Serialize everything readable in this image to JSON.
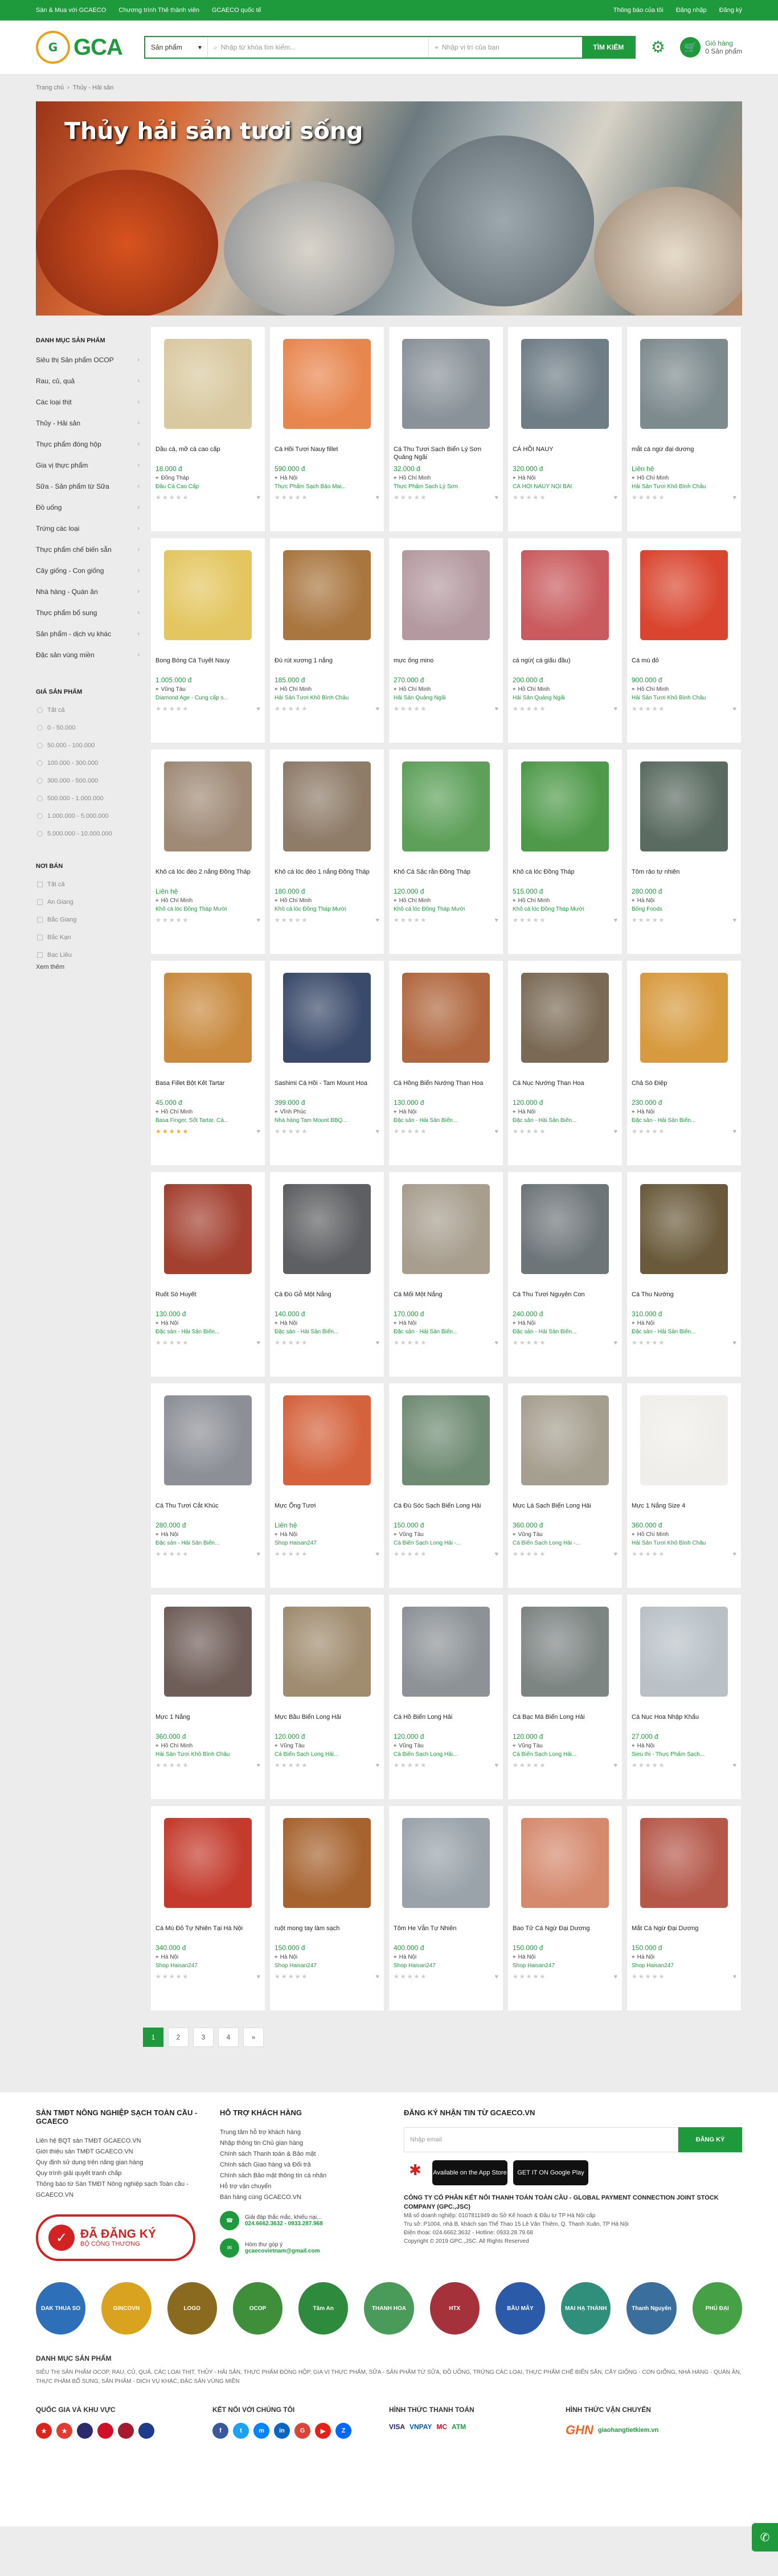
{
  "topbar": {
    "links_left": [
      "Sàn & Mua với GCAECO",
      "Chương trình Thẻ thành viên",
      "GCAECO quốc tế"
    ],
    "links_right": [
      "Thông báo của tôi",
      "Đăng nhập",
      "Đăng ký"
    ]
  },
  "header": {
    "logo_text": "GCA",
    "logo_mark": "G",
    "search_category": "Sản phẩm",
    "search_placeholder": "Nhập từ khóa tìm kiếm...",
    "location_placeholder": "Nhập vị trí của bạn",
    "search_button": "TÌM KIẾM",
    "cart_title": "Giỏ hàng",
    "cart_count": "0 Sản phẩm"
  },
  "breadcrumb": [
    "Trang chủ",
    "Thủy - Hải sản"
  ],
  "hero": {
    "title": "Thủy hải sản tươi sống"
  },
  "sidebar": {
    "cat_title": "DANH MỤC SẢN PHẨM",
    "categories": [
      "Siêu thị Sản phẩm OCOP",
      "Rau, củ, quả",
      "Các loại thịt",
      "Thủy - Hải sản",
      "Thực phẩm đóng hộp",
      "Gia vị thực phẩm",
      "Sữa - Sản phẩm từ Sữa",
      "Đồ uống",
      "Trứng các loại",
      "Thực phẩm chế biến sẵn",
      "Cây giống - Con giống",
      "Nhà hàng - Quán ăn",
      "Thực phẩm bổ sung",
      "Sản phẩm - dịch vụ khác",
      "Đặc sản vùng miền"
    ],
    "price_title": "GIÁ SẢN PHẨM",
    "prices": [
      "Tất cả",
      "0 - 50.000",
      "50.000 - 100.000",
      "100.000 - 300.000",
      "300.000 - 500.000",
      "500.000 - 1.000.000",
      "1.000.000 - 5.000.000",
      "5.000.000 - 10.000.000"
    ],
    "place_title": "NƠI BÁN",
    "places": [
      "Tất cả",
      "An Giang",
      "Bắc Giang",
      "Bắc Kạn",
      "Bạc Liêu"
    ],
    "see_more": "Xem thêm"
  },
  "products": [
    {
      "name": "Dầu cá, mỡ cá cao cấp",
      "price": "18.000 đ",
      "loc": "Đồng Tháp",
      "shop": "Đầu Cá Cao Cấp",
      "color": "#d9c9a0",
      "rating": 0
    },
    {
      "name": "Cá Hồi Tươi Nauy fillet",
      "price": "590.000 đ",
      "loc": "Hà Nội",
      "shop": "Thực Phẩm Sạch Bảo Mai...",
      "color": "#e8864f",
      "rating": 0
    },
    {
      "name": "Cá Thu Tươi Sạch Biển Lý Sơn Quảng Ngãi",
      "price": "32.000 đ",
      "loc": "Hồ Chí Minh",
      "shop": "Thực Phẩm Sạch Lý Sơn",
      "color": "#8a9299",
      "rating": 0
    },
    {
      "name": "CÁ HỒI NAUY",
      "price": "320.000 đ",
      "loc": "Hà Nội",
      "shop": "CÁ HỒI NAUY NỘI BÀI",
      "color": "#6f7d86",
      "rating": 0
    },
    {
      "name": "mắt cá ngừ đại dương",
      "price": "Liên hệ",
      "loc": "Hồ Chí Minh",
      "shop": "Hải Sản Tươi Khô Bình Châu",
      "color": "#7d8a8e",
      "rating": 0
    },
    {
      "name": "Bong Bóng Cá Tuyết Nauy",
      "price": "1.005.000 đ",
      "loc": "Vũng Tàu",
      "shop": "Diamond Age - Cung cấp s...",
      "color": "#e3c660",
      "rating": 0
    },
    {
      "name": "Đù rút xương 1 nắng",
      "price": "185.000 đ",
      "loc": "Hồ Chí Minh",
      "shop": "Hải Sản Tươi Khô Bình Châu",
      "color": "#a9763f",
      "rating": 0
    },
    {
      "name": "mực ống mino",
      "price": "270.000 đ",
      "loc": "Hồ Chí Minh",
      "shop": "Hải Sản Quảng Ngãi",
      "color": "#b49aa0",
      "rating": 0
    },
    {
      "name": "cá ngừ( cá giấu đầu)",
      "price": "200.000 đ",
      "loc": "Hồ Chí Minh",
      "shop": "Hải Sản Quảng Ngãi",
      "color": "#c95b5e",
      "rating": 0
    },
    {
      "name": "Cá mú đỏ",
      "price": "900.000 đ",
      "loc": "Hồ Chí Minh",
      "shop": "Hải Sản Tươi Khô Bình Châu",
      "color": "#d9452e",
      "rating": 0
    },
    {
      "name": "Khô cá lóc đéo 2 nắng Đồng Tháp",
      "price": "Liên hệ",
      "loc": "Hồ Chí Minh",
      "shop": "Khô cá lóc Đồng Tháp Mười",
      "color": "#9f8a76",
      "rating": 0
    },
    {
      "name": "Khô cá lóc đéo 1 nắng Đồng Tháp",
      "price": "180.000 đ",
      "loc": "Hồ Chí Minh",
      "shop": "Khô cá lóc Đồng Tháp Mười",
      "color": "#8e7b68",
      "rating": 0
    },
    {
      "name": "Khô Cá Sặc rằn Đồng Tháp",
      "price": "120.000 đ",
      "loc": "Hồ Chí Minh",
      "shop": "Khô cá lóc Đồng Tháp Mười",
      "color": "#5ea05a",
      "rating": 0
    },
    {
      "name": "Khô cá lóc Đồng Tháp",
      "price": "515.000 đ",
      "loc": "Hồ Chí Minh",
      "shop": "Khô cá lóc Đồng Tháp Mười",
      "color": "#4f9a4a",
      "rating": 0
    },
    {
      "name": "Tôm rảo tự nhiên",
      "price": "280.000 đ",
      "loc": "Hà Nội",
      "shop": "Bống Foods",
      "color": "#5a6b61",
      "rating": 0
    },
    {
      "name": "Basa Fillet Bột Kết Tartar",
      "price": "45.000 đ",
      "loc": "Hồ Chí Minh",
      "shop": "Basa Finger, Sốt Tartar, Cá...",
      "color": "#c98a3e",
      "rating": 5
    },
    {
      "name": "Sashimi Cá Hồi - Tam Mount Hoa",
      "price": "399.000 đ",
      "loc": "Vĩnh Phúc",
      "shop": "Nhà hàng Tam Mount BBQ...",
      "color": "#3a4a6a",
      "rating": 0
    },
    {
      "name": "Cá Hồng Biển Nướng Than Hoa",
      "price": "130.000 đ",
      "loc": "Hà Nội",
      "shop": "Đặc sản - Hải Sản Biển...",
      "color": "#b0673f",
      "rating": 0
    },
    {
      "name": "Cá Nục Nướng Than Hoa",
      "price": "120.000 đ",
      "loc": "Hà Nội",
      "shop": "Đặc sản - Hải Sản Biển...",
      "color": "#7a6a55",
      "rating": 0
    },
    {
      "name": "Chả Sò Điệp",
      "price": "230.000 đ",
      "loc": "Hà Nội",
      "shop": "Đặc sản - Hải Sản Biển...",
      "color": "#d79a3e",
      "rating": 0
    },
    {
      "name": "Ruốt Sò Huyết",
      "price": "130.000 đ",
      "loc": "Hà Nội",
      "shop": "Đặc sản - Hải Sản Biển...",
      "color": "#a3402f",
      "rating": 0
    },
    {
      "name": "Cá Đù Gỗ Một Nắng",
      "price": "140.000 đ",
      "loc": "Hà Nội",
      "shop": "Đặc sản - Hải Sản Biển...",
      "color": "#5d5f62",
      "rating": 0
    },
    {
      "name": "Cá Mối Một Nắng",
      "price": "170.000 đ",
      "loc": "Hà Nội",
      "shop": "Đặc sản - Hải Sản Biển...",
      "color": "#a79e8e",
      "rating": 0
    },
    {
      "name": "Cá Thu Tươi Nguyên Con",
      "price": "240.000 đ",
      "loc": "Hà Nội",
      "shop": "Đặc sản - Hải Sản Biển...",
      "color": "#6e7579",
      "rating": 0
    },
    {
      "name": "Cá Thu Nướng",
      "price": "310.000 đ",
      "loc": "Hà Nội",
      "shop": "Đặc sản - Hải Sản Biển...",
      "color": "#6a5a3b",
      "rating": 0
    },
    {
      "name": "Cá Thu Tươi Cắt Khúc",
      "price": "280.000 đ",
      "loc": "Hà Nội",
      "shop": "Đặc sản - Hải Sản Biển...",
      "color": "#8c8f96",
      "rating": 0
    },
    {
      "name": "Mực Ống Tươi",
      "price": "Liên hệ",
      "loc": "Hà Nội",
      "shop": "Shop Haisan247",
      "color": "#d4623c",
      "rating": 0
    },
    {
      "name": "Cá Đù Sóc Sạch Biển Long Hải",
      "price": "150.000 đ",
      "loc": "Vũng Tàu",
      "shop": "Cá Biển Sạch Long Hải -...",
      "color": "#6f8b73",
      "rating": 0
    },
    {
      "name": "Mực Lá Sạch Biển Long Hải",
      "price": "360.000 đ",
      "loc": "Vũng Tàu",
      "shop": "Cá Biển Sạch Long Hải -...",
      "color": "#a59f8f",
      "rating": 0
    },
    {
      "name": "Mực 1 Nắng Size 4",
      "price": "360.000 đ",
      "loc": "Hồ Chí Minh",
      "shop": "Hải Sản Tươi Khô Bình Châu",
      "color": "#efeeea",
      "rating": 0
    },
    {
      "name": "Mực 1 Nắng",
      "price": "360.000 đ",
      "loc": "Hồ Chí Minh",
      "shop": "Hải Sản Tươi Khô Bình Châu",
      "color": "#6f5d58",
      "rating": 0
    },
    {
      "name": "Mực Bầu Biển Long Hải",
      "price": "120.000 đ",
      "loc": "Vũng Tàu",
      "shop": "Cá Biển Sạch Long Hải...",
      "color": "#a08c6f",
      "rating": 0
    },
    {
      "name": "Cá Hồ Biển Long Hải",
      "price": "120.000 đ",
      "loc": "Vũng Tàu",
      "shop": "Cá Biển Sạch Long Hải...",
      "color": "#8c9296",
      "rating": 0
    },
    {
      "name": "Cá Bạc Má Biển Long Hải",
      "price": "120.000 đ",
      "loc": "Vũng Tàu",
      "shop": "Cá Biển Sạch Long Hải...",
      "color": "#7d8583",
      "rating": 0
    },
    {
      "name": "Cá Nục Hoa Nhập Khẩu",
      "price": "27.000 đ",
      "loc": "Hà Nội",
      "shop": "Sieu thi - Thực Phẩm Sạch...",
      "color": "#b9c1c7",
      "rating": 0
    },
    {
      "name": "Cá Mú Đỏ Tự Nhiên Tại Hà Nội",
      "price": "340.000 đ",
      "loc": "Hà Nội",
      "shop": "Shop Haisan247",
      "color": "#c43a2c",
      "rating": 0
    },
    {
      "name": "ruột mong tay làm sạch",
      "price": "150.000 đ",
      "loc": "Hà Nội",
      "shop": "Shop Haisan247",
      "color": "#a6632f",
      "rating": 0
    },
    {
      "name": "Tôm He Vẫn Tự Nhiên",
      "price": "400.000 đ",
      "loc": "Hà Nội",
      "shop": "Shop Haisan247",
      "color": "#9aa3aa",
      "rating": 0
    },
    {
      "name": "Bao Tử Cá Ngừ Đại Dương",
      "price": "150.000 đ",
      "loc": "Hà Nội",
      "shop": "Shop Haisan247",
      "color": "#d58a6e",
      "rating": 0
    },
    {
      "name": "Mắt Cá Ngừ Đại Dương",
      "price": "150.000 đ",
      "loc": "Hà Nội",
      "shop": "Shop Haisan247",
      "color": "#b5584a",
      "rating": 0
    }
  ],
  "pagination": [
    "1",
    "2",
    "3",
    "4",
    "»"
  ],
  "footer": {
    "col1_title": "SÀN TMĐT NÔNG NGHIỆP SẠCH TOÀN CẦU - GCAECO",
    "col1_links": [
      "Liên hệ BQT sàn TMĐT GCAECO.VN",
      "Giới thiệu sàn TMĐT GCAECO.VN",
      "Quy định sử dụng trên nâng gian hàng",
      "Quy trình giải quyết tranh chấp",
      "Thông báo từ Sàn TMĐT Nông nghiệp sạch Toàn cầu - GCAECO.VN"
    ],
    "col2_title": "HỖ TRỢ KHÁCH HÀNG",
    "col2_links": [
      "Trung tâm hỗ trợ khách hàng",
      "Nhập thông tin Chủ gian hàng",
      "Chính sách Thanh toán & Bảo mật",
      "Chính sách Giao hàng và Đổi trả",
      "Chính sách Bảo mật thông tin cá nhân",
      "Hỗ trợ vận chuyển",
      "Bán hàng cùng GCAECO.VN"
    ],
    "hotline_label": "Giải đáp thắc mắc, khiếu nại...",
    "hotline": "024.6662.3632 - 0933.287.968",
    "email_label": "Hòm thư góp ý",
    "email": "gcaecovietnam@gmail.com",
    "col3_title": "ĐĂNG KÝ NHẬN TIN TỪ GCAECO.VN",
    "email_placeholder": "Nhập email",
    "email_button": "ĐĂNG KÝ",
    "app_store": "Available on the App Store",
    "google_play": "GET IT ON Google Play",
    "company": "CÔNG TY CỔ PHẦN KẾT NỐI THANH TOÁN TOÀN CẦU - GLOBAL PAYMENT CONNECTION JOINT STOCK COMPANY (GPC.,JSC)",
    "company_lines": [
      "Mã số doanh nghiệp: 0107811949 do Sở Kế hoạch & Đầu tư TP Hà Nội cấp",
      "Trụ sở: P1004, nhà B, khách sạn Thể Thao 15 Lê Văn Thiêm, Q. Thanh Xuân, TP Hà Nội",
      "Điện thoại: 024.6662.3632 - Hotline: 0933.28.79.68",
      "Copyright © 2019 GPC.,JSC. All Rights Reserved"
    ],
    "badge_title": "ĐÃ ĐĂNG KÝ",
    "badge_sub": "BỘ CÔNG THƯƠNG",
    "partners": [
      {
        "label": "DAK THUA SO",
        "color": "#2d6fb8"
      },
      {
        "label": "GINCOVN",
        "color": "#d9a21f"
      },
      {
        "label": "LOGO",
        "color": "#8a6a1f"
      },
      {
        "label": "OCOP",
        "color": "#3f8f3a"
      },
      {
        "label": "Tâm An",
        "color": "#2e8b3e"
      },
      {
        "label": "THANH HOA",
        "color": "#4a9a5a"
      },
      {
        "label": "HTX",
        "color": "#a5323a"
      },
      {
        "label": "BẦU MÂY",
        "color": "#2a5aa8"
      },
      {
        "label": "MAI HẠ THÀNH",
        "color": "#2f8f7a"
      },
      {
        "label": "Thanh Nguyên",
        "color": "#3a6e9c"
      },
      {
        "label": "PHÚ ĐẠI",
        "color": "#46a045"
      }
    ],
    "dcat_title": "DANH MỤC SẢN PHẨM",
    "dcat_text": "SIÊU THỊ SẢN PHẨM OCOP, RAU, CỦ, QUẢ, CÁC LOẠI THỊT, THỦY - HẢI SẢN, THỰC PHẨM ĐÓNG HỘP, GIA VỊ THỰC PHẨM, SỮA - SẢN PHẨM TỪ SỮA, ĐỒ UỐNG, TRỨNG CÁC LOẠI, THỰC PHẨM CHẾ BIẾN SẴN, CÂY GIỐNG - CON GIỐNG, NHÀ HÀNG - QUÁN ĂN, THỰC PHẨM BỔ SUNG, SẢN PHẨM - DỊCH VỤ KHÁC, ĐẶC SẢN VÙNG MIỀN",
    "countries_title": "QUỐC GIA VÀ KHU VỰC",
    "social_title": "KẾT NỐI VỚI CHÚNG TÔI",
    "pay_title": "HÌNH THỨC THANH TOÁN",
    "ship_title": "HÌNH THỨC VẬN CHUYỂN",
    "pay_methods": [
      "VISA",
      "VNPAY",
      "MC",
      "ATM"
    ],
    "ship_methods": [
      "GHN",
      "giaohangtietkiem.vn"
    ]
  }
}
